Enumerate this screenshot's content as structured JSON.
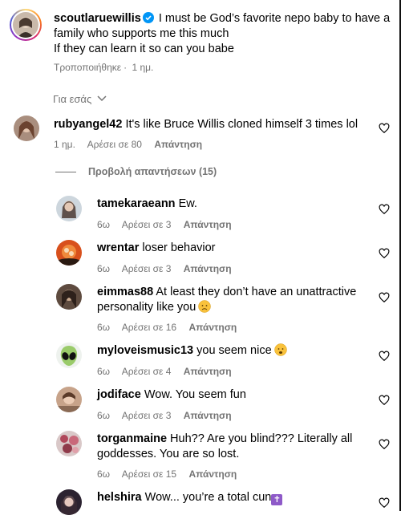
{
  "post": {
    "username": "scoutlaruewillis",
    "caption_line1": "I must be God’s favorite nepo baby to have a",
    "caption_line2": "family who supports me this much",
    "caption_line3": "If they can learn it so can you babe",
    "edited": "Τροποποιήθηκε",
    "time": "1 ημ."
  },
  "filter": {
    "label": "Για εσάς"
  },
  "top_comment": {
    "username": "rubyangel42",
    "text": "It's like Bruce Willis cloned himself 3 times lol",
    "time": "1 ημ.",
    "likes": "Αρέσει σε 80",
    "reply": "Απάντηση"
  },
  "view_replies": "Προβολή απαντήσεων (15)",
  "reply_label": "Απάντηση",
  "replies": [
    {
      "username": "tamekaraeann",
      "text": "Ew.",
      "time": "6ω",
      "likes": "Αρέσει σε 3"
    },
    {
      "username": "wrentar",
      "text": "loser behavior",
      "time": "6ω",
      "likes": "Αρέσει σε 3"
    },
    {
      "username": "eimmas88",
      "text": "At least they don’t have an unattractive",
      "text2": "personality like you",
      "time": "6ω",
      "likes": "Αρέσει σε 16"
    },
    {
      "username": "myloveismusic13",
      "text": "you seem nice",
      "time": "6ω",
      "likes": "Αρέσει σε 4"
    },
    {
      "username": "jodiface",
      "text": "Wow. You seem fun",
      "time": "6ω",
      "likes": "Αρέσει σε 3"
    },
    {
      "username": "torganmaine",
      "text": "Huh?? Are you blind??? Literally all",
      "text2": "goddesses. You are so lost.",
      "time": "6ω",
      "likes": "Αρέσει σε 15"
    },
    {
      "username": "helshira",
      "text": "Wow... you’re a total cun"
    }
  ],
  "colors": {
    "verified": "#0095f6",
    "meta_gray": "#737373"
  }
}
